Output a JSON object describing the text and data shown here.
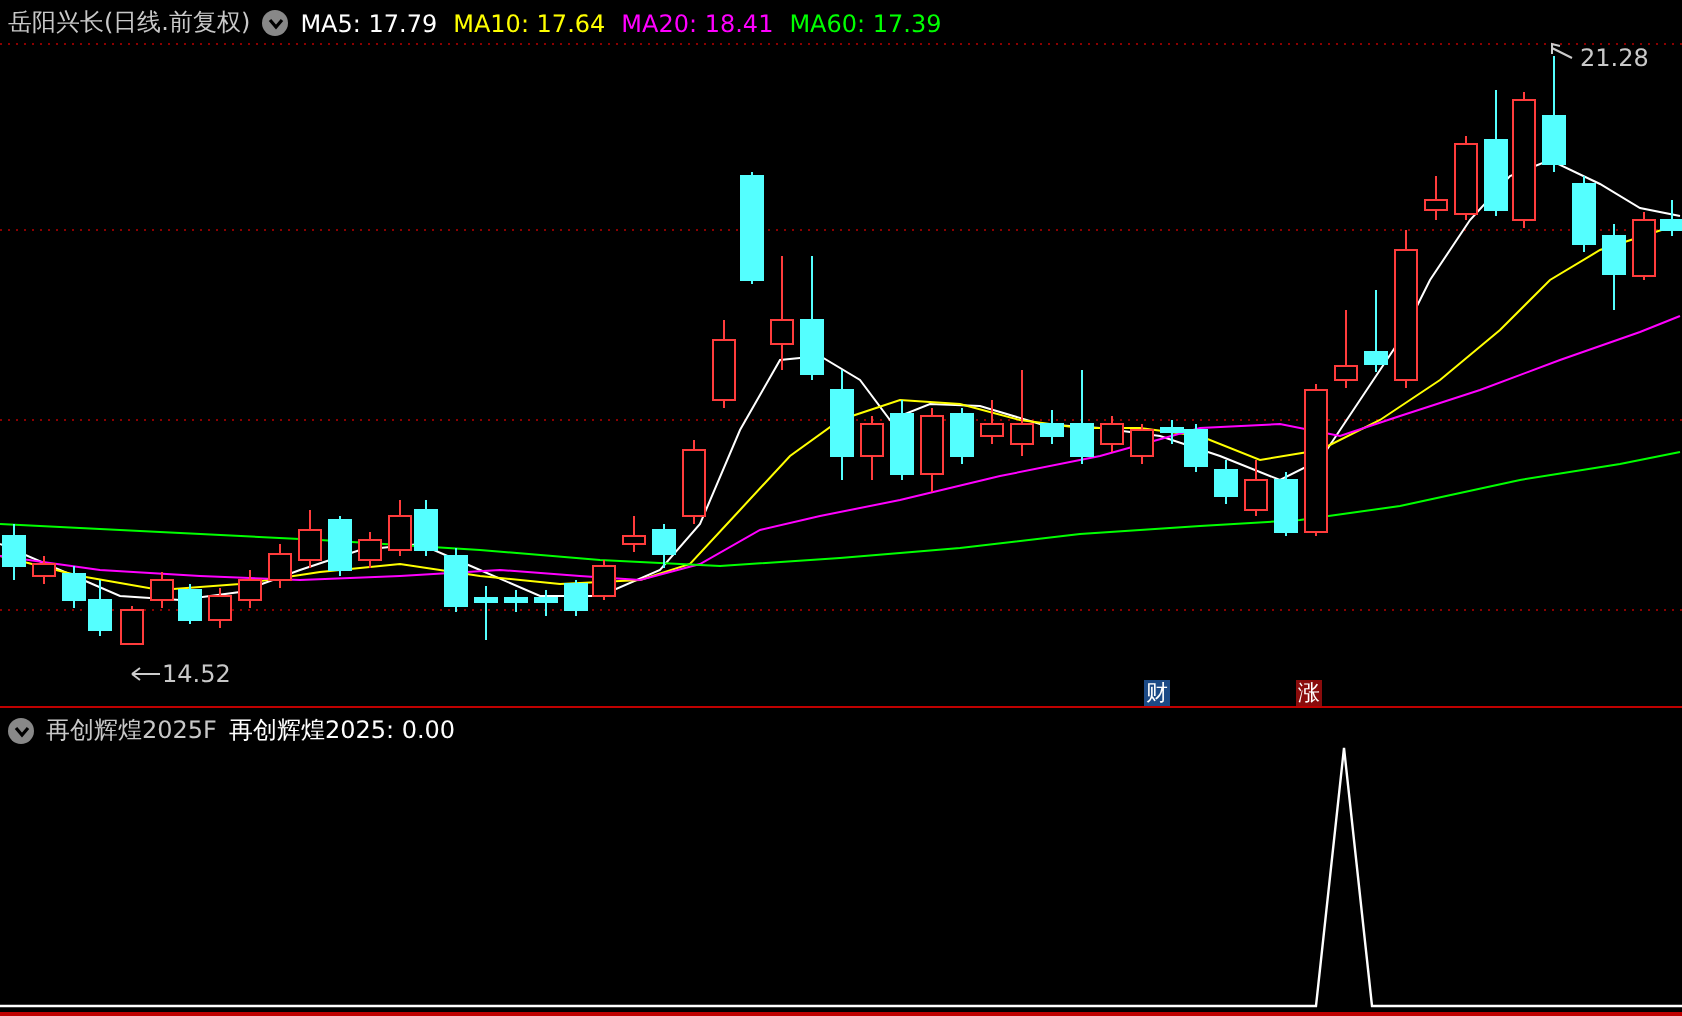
{
  "price_panel": {
    "title": "岳阳兴长(日线.前复权)",
    "indicators": [
      {
        "label": "MA5: 17.79",
        "color": "#ffffff"
      },
      {
        "label": "MA10: 17.64",
        "color": "#ffff00"
      },
      {
        "label": "MA20: 18.41",
        "color": "#ff00ff"
      },
      {
        "label": "MA60: 17.39",
        "color": "#00ff00"
      }
    ],
    "high_label": "21.28",
    "low_label": "14.52",
    "event_markers": [
      {
        "label": "财",
        "color": "#1c4a86"
      },
      {
        "label": "涨",
        "color": "#8a0c0c"
      }
    ]
  },
  "indicator_panel": {
    "name": "再创辉煌2025F",
    "reading": "再创辉煌2025: 0.00"
  }
}
